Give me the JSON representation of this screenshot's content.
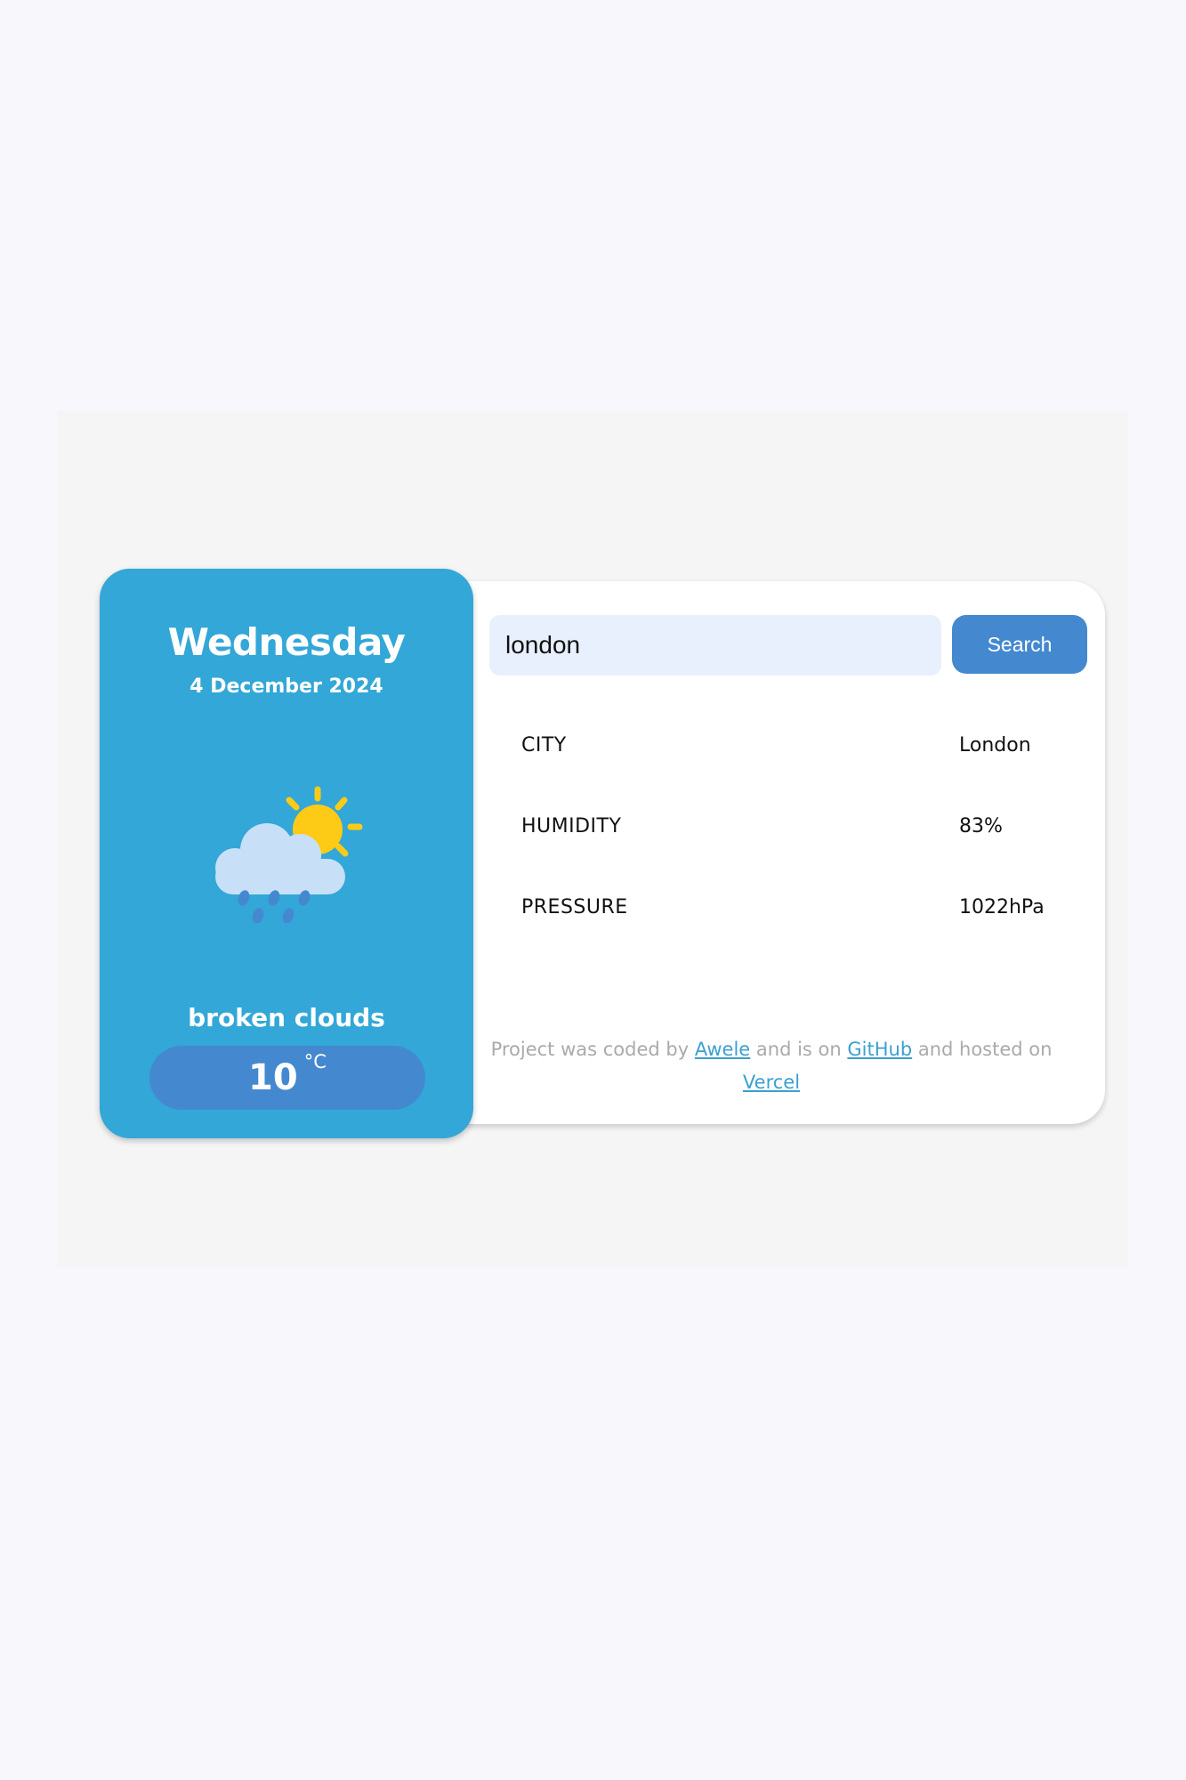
{
  "weather": {
    "day": "Wednesday",
    "date": "4 December 2024",
    "icon": "cloud-sun-rain-icon",
    "description": "broken clouds",
    "temperature": "10",
    "unit": "°C"
  },
  "search": {
    "value": "london",
    "button_label": "Search"
  },
  "stats": [
    {
      "label": "CITY",
      "value": "London"
    },
    {
      "label": "HUMIDITY",
      "value": "83%"
    },
    {
      "label": "PRESSURE",
      "value": "1022hPa"
    }
  ],
  "footer": {
    "text_1": "Project was coded by ",
    "author_link": "Awele",
    "text_2": " and is on ",
    "github_link": "GitHub",
    "text_3": " and hosted on ",
    "vercel_link": "Vercel"
  },
  "colors": {
    "panel": "#33a7d7",
    "accent": "#4489cf",
    "link": "#3c9fcf",
    "sun": "#fdcb16"
  }
}
